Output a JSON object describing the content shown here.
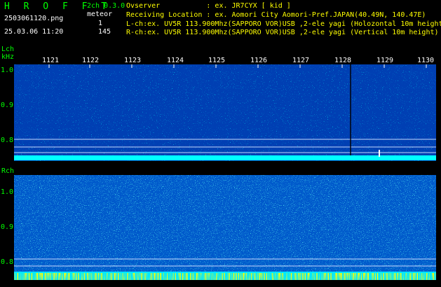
{
  "header": {
    "brand": "H R O F F T",
    "mode": "2ch 0.3.0",
    "meteor_label": "meteor",
    "meteor_l_count": "1",
    "meteor_r_count": "145",
    "filename": "2503061120.png",
    "datetime": "25.03.06 11:20",
    "observer_line": "Ovserver           : ex. JR7CYX [ kid ]",
    "location_line": "Receiving Location : ex. Aomori City Aomori-Pref.JAPAN(40.49N, 140.47E)",
    "lch_line": "L-ch:ex. UV5R 113.900Mhz(SAPPORO VOR)USB ,2-ele yagi (Holozontal 10m height)",
    "rch_line": "R-ch:ex. UV5R 113.900Mhz(SAPPORO VOR)USB ,2-ele yagi (Vertical 10m height)"
  },
  "lch": {
    "label": "Lch",
    "unit": "kHz",
    "y_ticks": [
      "1.0",
      "0.9",
      "0.8"
    ]
  },
  "rch": {
    "label": "Rch",
    "y_ticks": [
      "1.0",
      "0.9",
      "0.8"
    ]
  },
  "time_ticks": [
    "1121",
    "1122",
    "1123",
    "1124",
    "1125",
    "1126",
    "1127",
    "1128",
    "1129",
    "1130"
  ],
  "colors": {
    "text_green": "#00ff00",
    "text_yellow": "#ffff00",
    "background": "#000000",
    "noise_low": "#0a1a8c",
    "noise_high": "#00ffff"
  }
}
